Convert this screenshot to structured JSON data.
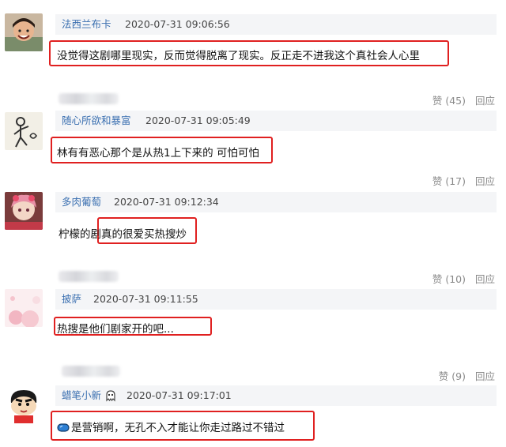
{
  "comments": [
    {
      "user": "法西兰布卡",
      "time": "2020-07-31 09:06:56",
      "text": "没觉得这剧哪里现实，反而觉得脱离了现实。反正走不进我这个真社会人心里",
      "like_label": "赞 (45)",
      "reply_label": "回应"
    },
    {
      "user": "随心所欲和暴富",
      "time": "2020-07-31 09:05:49",
      "text": "林有有恶心那个是从热1上下来的 可怕可怕",
      "like_label": "赞 (17)",
      "reply_label": "回应"
    },
    {
      "user": "多肉葡萄",
      "time": "2020-07-31 09:12:34",
      "text": "柠檬的剧真的很爱买热搜炒",
      "like_label": "赞 (10)",
      "reply_label": "回应"
    },
    {
      "user": "披萨",
      "time": "2020-07-31 09:11:55",
      "text": "热搜是他们剧家开的吧...",
      "like_label": "赞 (9)",
      "reply_label": "回应"
    },
    {
      "user": "蜡笔小新",
      "time": "2020-07-31 09:17:01",
      "text": "是营销啊，无孔不入才能让你走过路过不错过",
      "user_badge_icon": "ghost-icon",
      "text_prefix_icon": "blue-gem-icon"
    }
  ],
  "colors": {
    "username": "#3a6fb0",
    "highlight_border": "#e02020",
    "meta_bar_bg": "#f4f5f7",
    "action_text": "#8a8a8a"
  }
}
